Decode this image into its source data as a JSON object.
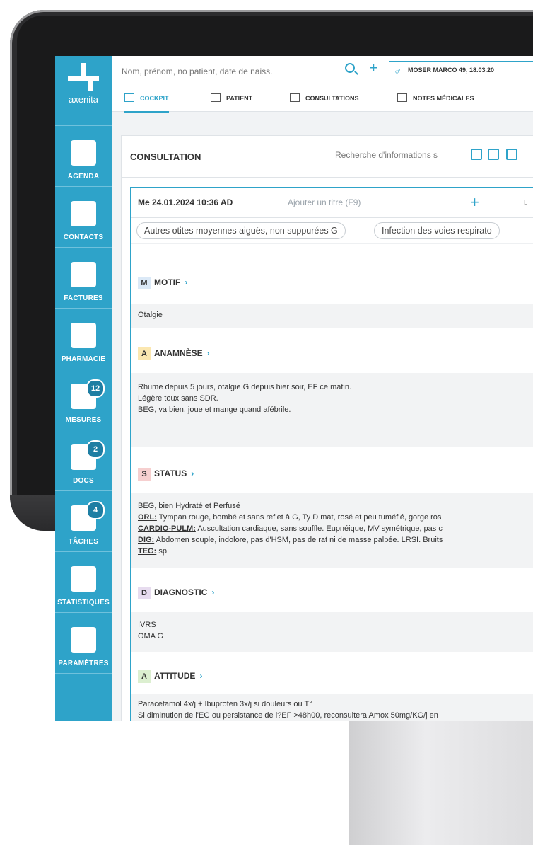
{
  "app": {
    "logo_text": "axenita"
  },
  "sidebar": {
    "items": [
      {
        "label": "AGENDA",
        "icon": "calendar-icon",
        "badge": ""
      },
      {
        "label": "CONTACTS",
        "icon": "contact-card-icon",
        "badge": ""
      },
      {
        "label": "FACTURES",
        "icon": "coins-icon",
        "badge": ""
      },
      {
        "label": "PHARMACIE",
        "icon": "cross-icon",
        "badge": ""
      },
      {
        "label": "MESURES",
        "icon": "flask-icon",
        "badge": "12"
      },
      {
        "label": "DOCS",
        "icon": "document-icon",
        "badge": "2"
      },
      {
        "label": "TÂCHES",
        "icon": "checklist-icon",
        "badge": "4"
      },
      {
        "label": "STATISTIQUES",
        "icon": "pie-chart-icon",
        "badge": ""
      },
      {
        "label": "PARAMÈTRES",
        "icon": "gear-icon",
        "badge": ""
      }
    ]
  },
  "topbar": {
    "search_placeholder": "Nom, prénom, no patient, date de naiss.",
    "patient": "MOSER MARCO 49, 18.03.20"
  },
  "tabs": [
    {
      "label": "COCKPIT",
      "active": true
    },
    {
      "label": "PATIENT",
      "active": false
    },
    {
      "label": "CONSULTATIONS",
      "active": false
    },
    {
      "label": "NOTES MÉDICALES",
      "active": false
    }
  ],
  "panel": {
    "title": "CONSULTATION",
    "info_search_placeholder": "Recherche d'informations s"
  },
  "consultation": {
    "date": "Me 24.01.2024  10:36  AD",
    "title_placeholder": "Ajouter un titre (F9)",
    "right_label": "L",
    "chips": [
      "Autres otites moyennes aiguës, non suppurées G",
      "Infection des voies respirato"
    ],
    "sections": {
      "motif": {
        "letter": "M",
        "title": "MOTIF",
        "lines": [
          "Otalgie"
        ]
      },
      "anamnese": {
        "letter": "A",
        "title": "ANAMNÈSE",
        "lines": [
          "Rhume depuis 5 jours, otalgie G depuis hier soir, EF ce matin.",
          "Légère toux sans SDR.",
          "BEG, va bien, joue et mange quand afébrile."
        ]
      },
      "status": {
        "letter": "S",
        "title": "STATUS",
        "line1": "BEG, bien Hydraté et Perfusé",
        "orl_label": "ORL:",
        "orl_text": " Tympan rouge, bombé et sans reflet à G, Ty D mat, rosé et peu tuméfié, gorge ros",
        "cardio_label": "CARDIO-PULM:",
        "cardio_text": " Auscultation cardiaque, sans souffle. Eupnéique, MV symétrique, pas c",
        "dig_label": "DIG:",
        "dig_text": " Abdomen souple, indolore, pas d'HSM, pas de rat ni de masse palpée. LRSI. Bruits",
        "teg_label": "TEG:",
        "teg_text": " sp"
      },
      "diagnostic": {
        "letter": "D",
        "title": "DIAGNOSTIC",
        "lines": [
          "IVRS",
          "OMA G"
        ]
      },
      "attitude": {
        "letter": "A",
        "title": "ATTITUDE",
        "lines": [
          "Paracetamol 4x/j + Ibuprofen 3x/j si douleurs ou T°",
          "Si diminution de l'EG ou persistance de l?EF >48h00, reconsultera Amox 50mg/KG/j en"
        ]
      }
    }
  },
  "colors": {
    "sidebar": "#2ea3c9",
    "motif": "#dbe9f7",
    "anamnese": "#fbe7b0",
    "status": "#f6cfcf",
    "diagnostic": "#e7dcef",
    "attitude": "#dcefd0"
  }
}
